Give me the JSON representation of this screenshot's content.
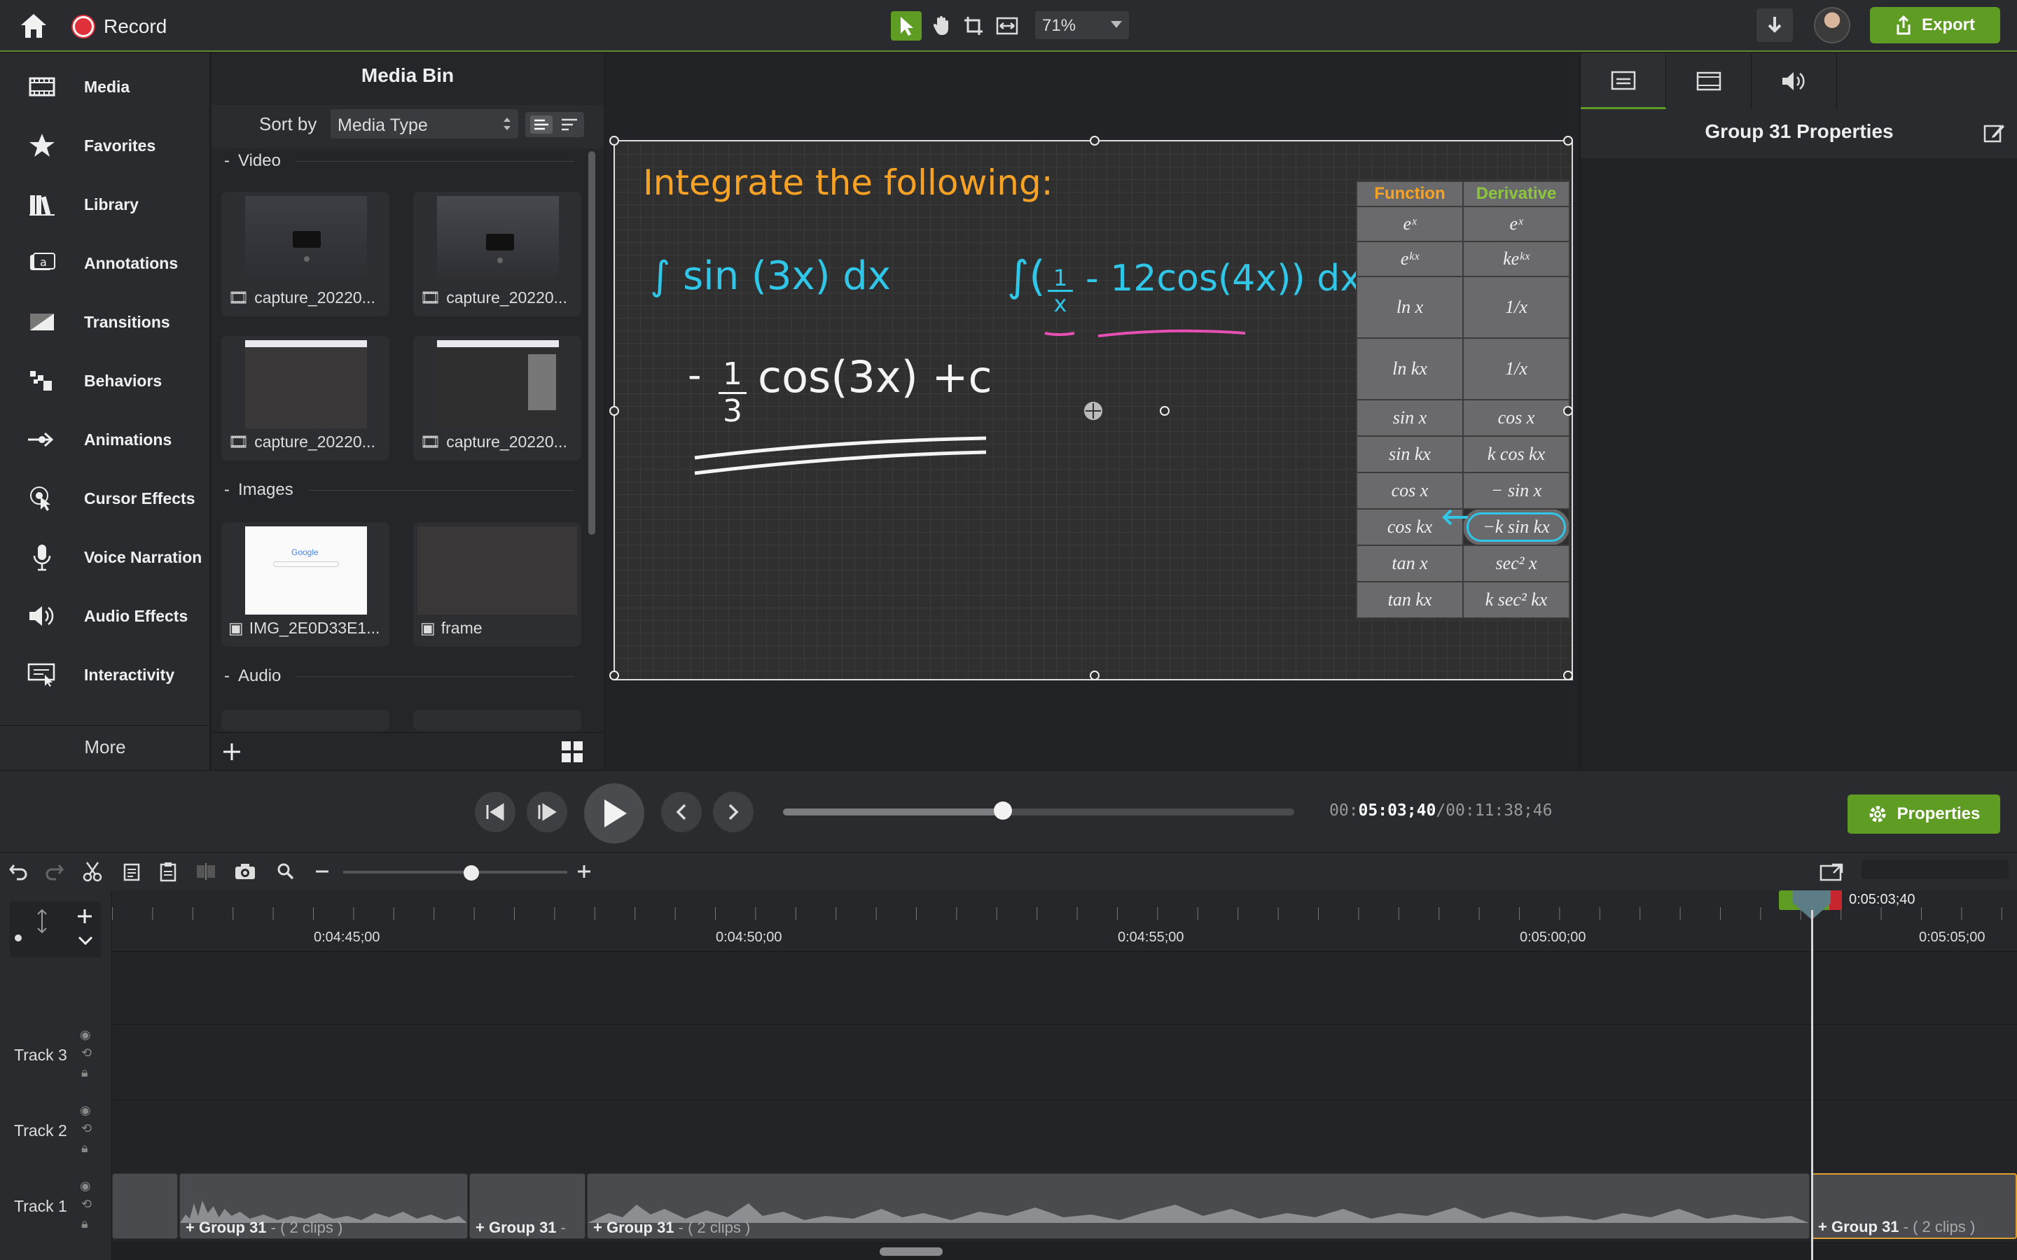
{
  "toolbar": {
    "record_label": "Record",
    "zoom_value": "71%",
    "export_label": "Export"
  },
  "sidebar": {
    "items": [
      {
        "label": "Media",
        "icon": "film-icon"
      },
      {
        "label": "Favorites",
        "icon": "star-icon"
      },
      {
        "label": "Library",
        "icon": "books-icon"
      },
      {
        "label": "Annotations",
        "icon": "annotation-icon"
      },
      {
        "label": "Transitions",
        "icon": "transition-icon"
      },
      {
        "label": "Behaviors",
        "icon": "behaviors-icon"
      },
      {
        "label": "Animations",
        "icon": "arrow-right-icon"
      },
      {
        "label": "Cursor Effects",
        "icon": "cursor-icon"
      },
      {
        "label": "Voice Narration",
        "icon": "microphone-icon"
      },
      {
        "label": "Audio Effects",
        "icon": "speaker-icon"
      },
      {
        "label": "Interactivity",
        "icon": "interactivity-icon"
      }
    ],
    "more_label": "More"
  },
  "media_bin": {
    "title": "Media Bin",
    "sort_label": "Sort by",
    "sort_value": "Media Type",
    "sections": {
      "video": "Video",
      "images": "Images",
      "audio": "Audio"
    },
    "video_items": [
      "capture_20220...",
      "capture_20220...",
      "capture_20220...",
      "capture_20220..."
    ],
    "image_items": [
      "IMG_2E0D33E1...",
      "frame"
    ]
  },
  "canvas": {
    "heading": "Integrate  the  following:",
    "integral_1": "∫ sin (3x) dx",
    "integral_2_open": "∫(",
    "integral_2_frac_num": "1",
    "integral_2_frac_den": "x",
    "integral_2_rest": "- 12cos(4x)) dx",
    "answer_prefix": "-",
    "answer_num": "1",
    "answer_den": "3",
    "answer_rest": "cos(3x) +c",
    "table": {
      "headers": [
        "Function",
        "Derivative"
      ],
      "header_colors": [
        "#f7a224",
        "#8cc63f"
      ],
      "rows": [
        [
          "eˣ",
          "eˣ"
        ],
        [
          "eᵏˣ",
          "keᵏˣ"
        ],
        [
          "ln x",
          "1/x"
        ],
        [
          "ln kx",
          "1/x"
        ],
        [
          "sin x",
          "cos x"
        ],
        [
          "sin kx",
          "k cos kx"
        ],
        [
          "cos x",
          "− sin x"
        ],
        [
          "cos kx",
          "−k sin kx"
        ],
        [
          "tan x",
          "sec² x"
        ],
        [
          "tan kx",
          "k sec² kx"
        ]
      ]
    },
    "colors": {
      "orange": "#f7a224",
      "cyan": "#2fc6e8",
      "pink": "#e64fb3",
      "white": "#f4f4f4"
    }
  },
  "properties": {
    "title": "Group 31 Properties",
    "button_label": "Properties"
  },
  "player": {
    "time_current_prefix": "00:",
    "time_current_main": "05:03;40",
    "time_total": "/00:11:38;46",
    "progress": 0.43
  },
  "timeline": {
    "ticks": [
      "0:04:45;00",
      "0:04:50;00",
      "0:04:55;00",
      "0:05:00;00",
      "0:05:05;00"
    ],
    "playhead_time": "0:05:03;40",
    "tracks": [
      "Track 3",
      "Track 2",
      "Track 1"
    ],
    "clips": [
      {
        "name": "Group 31",
        "extra": " - ( 2 clips )"
      },
      {
        "name": "Group 31",
        "extra": " - "
      },
      {
        "name": "Group 31",
        "extra": " - ( 2 clips )"
      },
      {
        "name": "Group 31",
        "extra": " - ( 2 clips )"
      }
    ]
  }
}
